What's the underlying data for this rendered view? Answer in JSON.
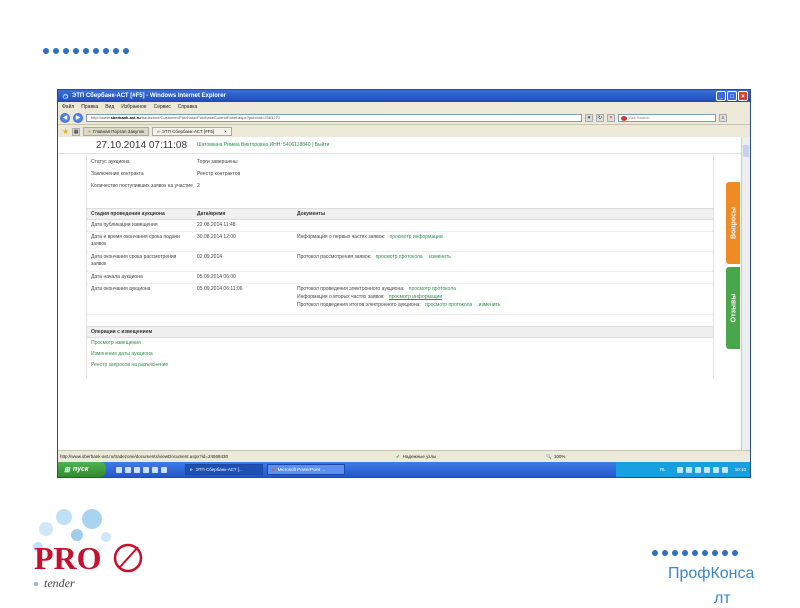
{
  "window": {
    "title": "ЭТП Сбербанк-АСТ [#F5] - Windows Internet Explorer",
    "buttons": [
      "_",
      "□",
      "×"
    ]
  },
  "menu": [
    "Файл",
    "Правка",
    "Вид",
    "Избранное",
    "Сервис",
    "Справка"
  ],
  "address": {
    "url_prefix": "http://www.",
    "url_domain": "sberbank-ast.ru",
    "url_rest": "/tradezone/Customer/Purchase/PurchaseControlPanel.aspx?purchid=2363270",
    "search_placeholder": "Ask Search"
  },
  "tabs": [
    {
      "label": "Главная Портал Закупок"
    },
    {
      "label": "ЭТП Сбербанк-АСТ [#F5]"
    }
  ],
  "header": {
    "datetime": "27.10.2014 07:11:08",
    "user": "Шатовкина Римма Викторовна ИНН: 5406118840 | Выйти"
  },
  "info": [
    {
      "label": "Статус аукциона",
      "value": "Торги завершены",
      "link": false
    },
    {
      "label": "Заключение контракта",
      "value": "Реестр контрактов",
      "link": true
    },
    {
      "label": "Количество поступивших заявок на участие",
      "value": "2",
      "link": false
    }
  ],
  "stages": {
    "columns": [
      "Стадия проведения аукциона",
      "Дата/время",
      "Документы"
    ],
    "rows": [
      {
        "stage": "Дата публикации извещения",
        "date": "22.08.2014 11:48",
        "docs": []
      },
      {
        "stage": "Дата и время окончания срока подачи заявок",
        "date": "30.08.2014 12:00",
        "docs": [
          {
            "text": "Информация о первых частях заявок:",
            "links": [
              "просмотр информации"
            ]
          }
        ]
      },
      {
        "stage": "Дата окончания срока рассмотрения заявок",
        "date": "02.09.2014",
        "docs": [
          {
            "text": "Протокол рассмотрения заявок:",
            "links": [
              "просмотр протокола",
              "изменить"
            ]
          }
        ]
      },
      {
        "stage": "Дата начала аукциона",
        "date": "05.09.2014 06:00",
        "docs": []
      },
      {
        "stage": "Дата окончания аукциона",
        "date": "05.09.2014 06:11:06",
        "docs": [
          {
            "text": "Протокол проведения электронного аукциона:",
            "links": [
              "просмотр протокола"
            ]
          },
          {
            "text": "Информация о вторых частях заявок:",
            "links": [
              "просмотр информации"
            ]
          },
          {
            "text": "Протокол подведения итогов электронного аукциона:",
            "links": [
              "просмотр протокола",
              "изменить"
            ]
          }
        ]
      }
    ]
  },
  "operations": {
    "title": "Операции с извещением",
    "items": [
      "Просмотр извещения",
      "Изменение даты аукциона",
      "Реестр запросов на разъяснение"
    ]
  },
  "side_tabs": {
    "questions": "Вопросы",
    "reviews": "Отзывы"
  },
  "statusbar": {
    "url": "http://www.sberbank-ast.ru/tradezone/documents/viewDocument.aspx?id=24568430",
    "zone": "Надежные узлы",
    "zoom": "100%"
  },
  "taskbar": {
    "start": "пуск",
    "tasks": [
      "ЭТП Сбербанк-АСТ [...",
      "Microsoft PowerPoint ..."
    ],
    "lang": "RL",
    "clock": "10:10"
  },
  "logo": {
    "text": "PRO",
    "sub": "tender"
  },
  "brand": {
    "line1": "ПрофКонса",
    "line2": "лт"
  },
  "colors": {
    "accent": "#2f6fbf",
    "link_green": "#2f8f4f",
    "questions_tab": "#f08a24",
    "reviews_tab": "#4aa64a"
  }
}
